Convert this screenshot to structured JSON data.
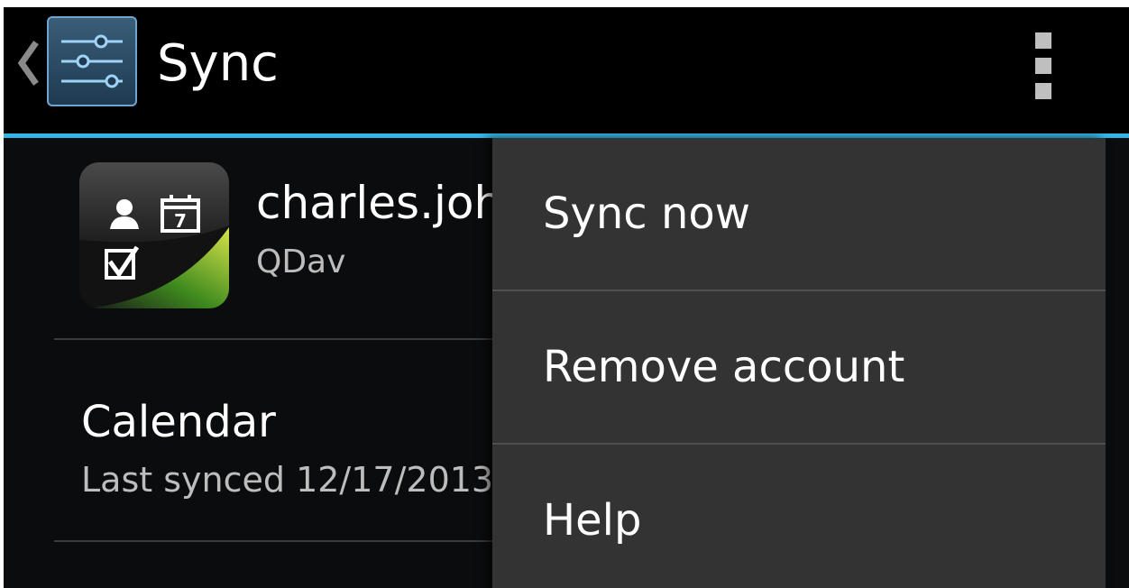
{
  "action_bar": {
    "title": "Sync",
    "app_icon": "settings-sliders-icon",
    "up_icon": "up-caret-icon",
    "overflow_icon": "overflow-menu-icon",
    "divider_color": "#33b5e5"
  },
  "account": {
    "name": "charles.joh",
    "type": "QDav",
    "icon": "contacts-calendar-tasks-icon",
    "icon_day": "7"
  },
  "sync_items": [
    {
      "title": "Calendar",
      "subtitle": "Last synced 12/17/2013"
    }
  ],
  "overflow_menu": {
    "items": [
      {
        "label": "Sync now"
      },
      {
        "label": "Remove account"
      },
      {
        "label": "Help"
      }
    ]
  }
}
